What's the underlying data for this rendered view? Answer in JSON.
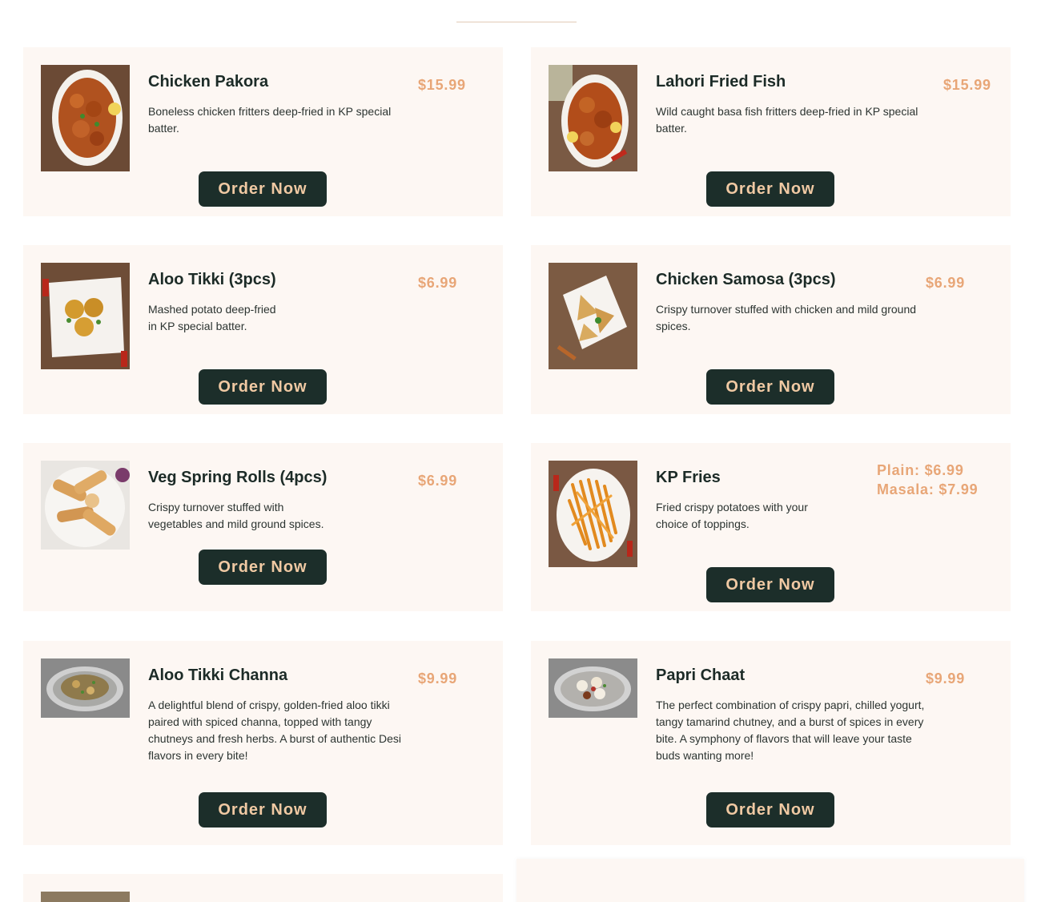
{
  "menu": {
    "button_label": "Order Now",
    "items": [
      {
        "name": "Chicken Pakora",
        "price": "$15.99",
        "description": "Boneless chicken fritters deep-fried in KP special batter."
      },
      {
        "name": "Lahori Fried Fish",
        "price": "$15.99",
        "description": "Wild caught basa fish fritters deep-fried in KP special batter."
      },
      {
        "name": "Aloo Tikki (3pcs)",
        "price": "$6.99",
        "description": "Mashed potato deep-fried in KP special batter."
      },
      {
        "name": "Chicken Samosa (3pcs)",
        "price": "$6.99",
        "description": "Crispy turnover stuffed with chicken and mild ground spices."
      },
      {
        "name": "Veg Spring Rolls (4pcs)",
        "price": "$6.99",
        "description": "Crispy turnover stuffed with vegetables and mild ground spices."
      },
      {
        "name": "KP Fries",
        "price_plain": "Plain: $6.99",
        "price_masala": "Masala: $7.99",
        "description": "Fried crispy potatoes with your choice of toppings."
      },
      {
        "name": "Aloo Tikki Channa",
        "price": "$9.99",
        "description": "A delightful blend of crispy, golden-fried aloo tikki paired with spiced channa, topped with tangy chutneys and fresh herbs. A burst of authentic Desi flavors in every bite!"
      },
      {
        "name": "Papri Chaat",
        "price": "$9.99",
        "description": "The perfect combination of crispy papri, chilled yogurt, tangy tamarind chutney, and a burst of spices in every bite. A symphony of flavors that will leave your taste buds wanting more!"
      }
    ]
  },
  "colors": {
    "card_bg": "#fdf7f3",
    "price": "#e8a677",
    "button_bg": "#1c2e2a",
    "button_text": "#f0c9a3",
    "title": "#1c2b27"
  }
}
